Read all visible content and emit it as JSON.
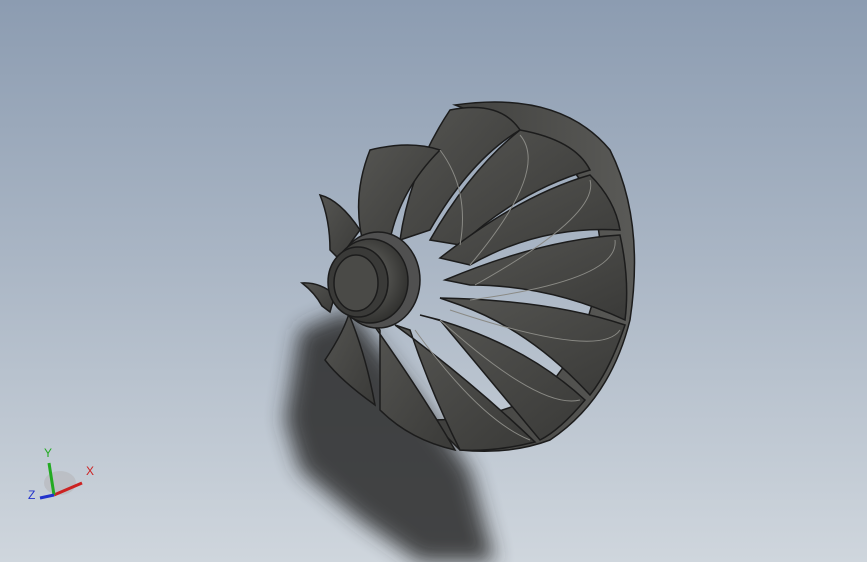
{
  "viewport": {
    "background_top": "#8c9cb1",
    "background_bottom": "#cfd6dd"
  },
  "model": {
    "part_color": "#4a4a48",
    "edge_color": "#1c1c1c"
  },
  "triad": {
    "x_label": "X",
    "y_label": "Y",
    "z_label": "Z",
    "x_color": "#cc2222",
    "y_color": "#22aa22",
    "z_color": "#2233cc"
  }
}
